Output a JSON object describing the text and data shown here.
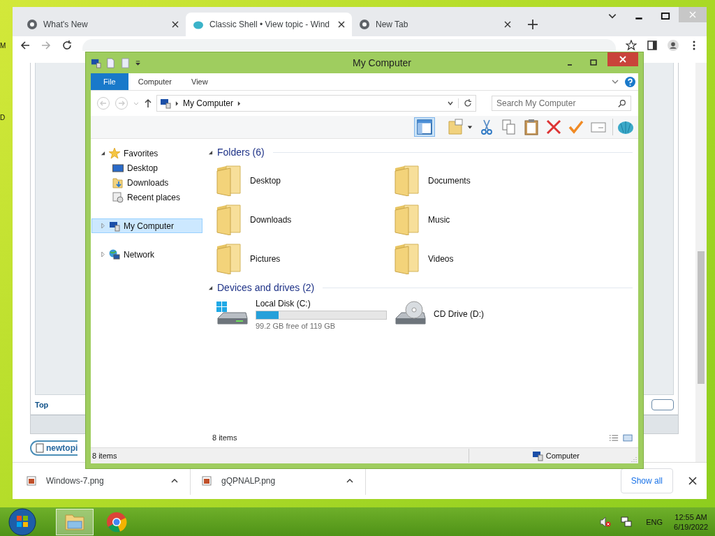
{
  "desktop_labels": [
    "M",
    "D"
  ],
  "browser": {
    "tabs": [
      {
        "title": "What's New",
        "selected": false
      },
      {
        "title": "Classic Shell • View topic - Wind",
        "selected": true
      },
      {
        "title": "New Tab",
        "selected": false
      }
    ],
    "page": {
      "top_link": "Top",
      "new_topic_button": "newtopi"
    },
    "downloads": [
      {
        "name": "Windows-7.png"
      },
      {
        "name": "gQPNALP.png"
      }
    ],
    "show_all": "Show all"
  },
  "explorer": {
    "title": "My Computer",
    "ribbon_tabs": [
      {
        "label": "File",
        "selected": true
      },
      {
        "label": "Computer",
        "selected": false
      },
      {
        "label": "View",
        "selected": false
      }
    ],
    "address": "My Computer",
    "search": {
      "placeholder": "Search My Computer"
    },
    "nav": [
      {
        "label": "Favorites",
        "kind": "favorites",
        "expanded": true,
        "selected": false,
        "children": [
          {
            "label": "Desktop",
            "kind": "desktop",
            "selected": false
          },
          {
            "label": "Downloads",
            "kind": "downloads",
            "selected": false
          },
          {
            "label": "Recent places",
            "kind": "recent",
            "selected": false
          }
        ]
      },
      {
        "label": "My Computer",
        "kind": "computer",
        "expanded": false,
        "selected": true
      },
      {
        "label": "Network",
        "kind": "network",
        "expanded": false,
        "selected": false
      }
    ],
    "groups": [
      {
        "title": "Folders (6)",
        "expanded": true,
        "items": [
          {
            "name": "Desktop",
            "kind": "folder"
          },
          {
            "name": "Documents",
            "kind": "folder"
          },
          {
            "name": "Downloads",
            "kind": "folder"
          },
          {
            "name": "Music",
            "kind": "folder"
          },
          {
            "name": "Pictures",
            "kind": "folder"
          },
          {
            "name": "Videos",
            "kind": "folder"
          }
        ]
      },
      {
        "title": "Devices and drives (2)",
        "expanded": true,
        "items": [
          {
            "name": "Local Disk (C:)",
            "kind": "disk",
            "level": 0.17,
            "free": "99.2 GB free of 119 GB"
          },
          {
            "name": "CD Drive (D:)",
            "kind": "cd"
          }
        ]
      }
    ],
    "item_count": "8 items",
    "status": {
      "items": "8 items",
      "location": "Computer"
    }
  },
  "taskbar": {
    "apps": [
      {
        "kind": "explorer",
        "active": true
      },
      {
        "kind": "chrome",
        "active": false
      }
    ],
    "language": "ENG",
    "time": "12:55 AM",
    "date": "6/19/2022"
  }
}
